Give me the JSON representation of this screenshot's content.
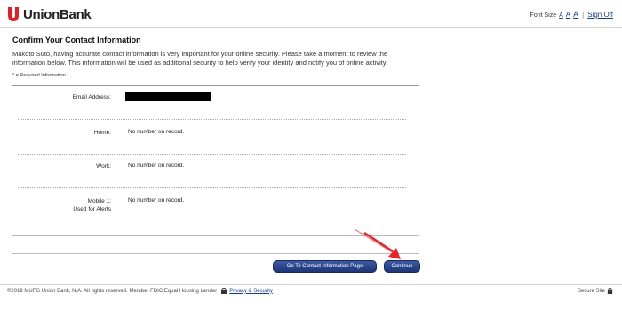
{
  "header": {
    "brand": "UnionBank",
    "font_size_label": "Font Size",
    "font_options": [
      "A",
      "A",
      "A"
    ],
    "separator": "|",
    "sign_off": "Sign Off"
  },
  "main": {
    "title": "Confirm Your Contact Information",
    "intro": "Makoto Suto, having accurate contact information is very important for your online security. Please take a moment to review the information below. This information will be used as additional security to help verify your identity and notify you of online activity.",
    "required_star": "*",
    "required_text": "= Required Information",
    "fields": [
      {
        "label": "Email Address:",
        "value": ""
      },
      {
        "label": "Home:",
        "value": "No number on record."
      },
      {
        "label": "Work:",
        "value": "No number on record."
      },
      {
        "label": "Mobile 1:",
        "sublabel": "Used for Alerts",
        "value": "No number on record."
      }
    ],
    "buttons": {
      "goto": "Go To Contact Information Page",
      "continue": "Continue"
    }
  },
  "footer": {
    "copyright": "©2019  MUFG Union Bank, N.A. All rights reserved. Member FDIC.Equal Housing Lender",
    "privacy": "Privacy & Security",
    "secure": "Secure Site"
  },
  "colors": {
    "brand_red": "#e41d24",
    "link_blue": "#1a3a8a",
    "button_blue": "#1d3577",
    "arrow_red": "#e8262a"
  }
}
